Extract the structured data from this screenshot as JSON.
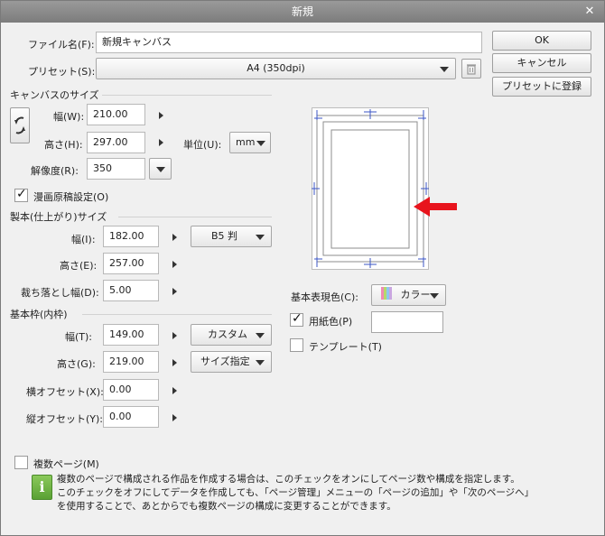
{
  "title": "新規",
  "file_name": {
    "label": "ファイル名(F):",
    "value": "新規キャンバス"
  },
  "preset": {
    "label": "プリセット(S):",
    "value": "A4 (350dpi)"
  },
  "buttons": {
    "ok": "OK",
    "cancel": "キャンセル",
    "register": "プリセットに登録"
  },
  "canvas_size": {
    "title": "キャンバスのサイズ",
    "width": {
      "label": "幅(W):",
      "value": "210.00"
    },
    "height": {
      "label": "高さ(H):",
      "value": "297.00"
    },
    "unit": {
      "label": "単位(U):",
      "value": "mm"
    },
    "resolution": {
      "label": "解像度(R):",
      "value": "350"
    }
  },
  "manga_setting": {
    "label": "漫画原稿設定(O)",
    "checked": true
  },
  "binding": {
    "title": "製本(仕上がり)サイズ",
    "width": {
      "label": "幅(I):",
      "value": "182.00",
      "preset": "B5 判"
    },
    "height": {
      "label": "高さ(E):",
      "value": "257.00"
    },
    "bleed": {
      "label": "裁ち落とし幅(D):",
      "value": "5.00"
    }
  },
  "frame": {
    "title": "基本枠(内枠)",
    "width": {
      "label": "幅(T):",
      "value": "149.00",
      "preset": "カスタム"
    },
    "height": {
      "label": "高さ(G):",
      "value": "219.00",
      "preset": "サイズ指定"
    },
    "offset_x": {
      "label": "横オフセット(X):",
      "value": "0.00"
    },
    "offset_y": {
      "label": "縦オフセット(Y):",
      "value": "0.00"
    }
  },
  "color": {
    "label": "基本表現色(C):",
    "value": "カラー"
  },
  "paper_color": {
    "label": "用紙色(P)",
    "checked": true,
    "color": "#ffffff"
  },
  "template": {
    "label": "テンプレート(T)",
    "checked": false
  },
  "multi_page": {
    "label": "複数ページ(M)",
    "checked": false
  },
  "info": {
    "line1": "複数のページで構成される作品を作成する場合は、このチェックをオンにしてページ数や構成を指定します。",
    "line2": "このチェックをオフにしてデータを作成しても、「ページ管理」メニューの「ページの追加」や「次のページへ」",
    "line3": "を使用することで、あとからでも複数ページの構成に変更することができます。"
  },
  "colors": {
    "accent_arrow": "#e8141d",
    "info_icon": "#6db33f",
    "preview_lines": "#3b55c4"
  }
}
